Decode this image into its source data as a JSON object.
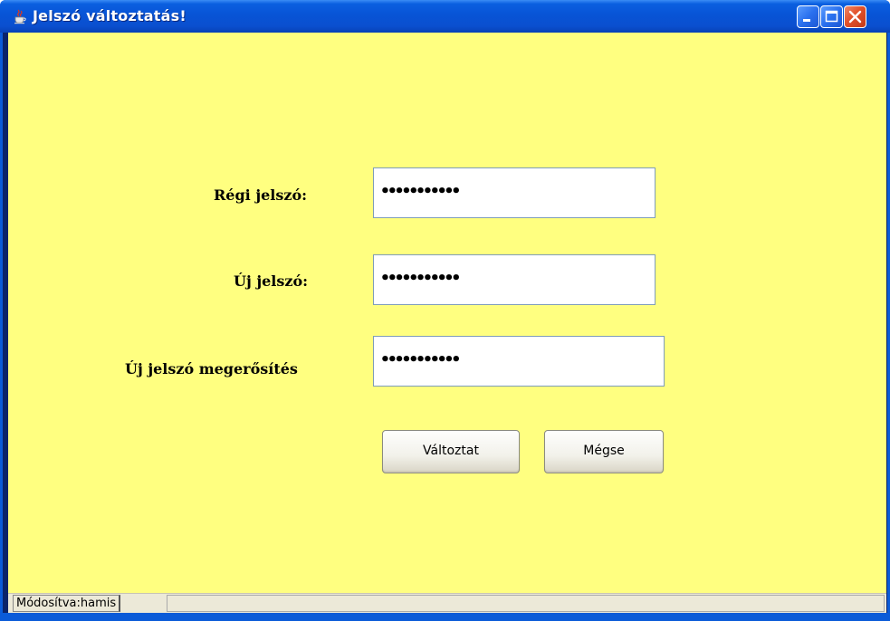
{
  "window": {
    "title": "Jelszó változtatás!",
    "colors": {
      "titlebar": "#0854d6",
      "background": "#ffff80",
      "close_button": "#e2512a"
    }
  },
  "form": {
    "old_password_label": "Régi jelszó:",
    "old_password_value": "•••••••••••",
    "new_password_label": "Új jelszó:",
    "new_password_value": "•••••••••••",
    "confirm_password_label": "Új jelszó megerősítés",
    "confirm_password_value": "•••••••••••"
  },
  "buttons": {
    "change_label": "Változtat",
    "cancel_label": "Mégse"
  },
  "statusbar": {
    "text": "Módosítva:hamis"
  },
  "icons": {
    "app": "java-cup-icon",
    "minimize": "minimize-icon",
    "maximize": "maximize-icon",
    "close": "close-icon"
  }
}
